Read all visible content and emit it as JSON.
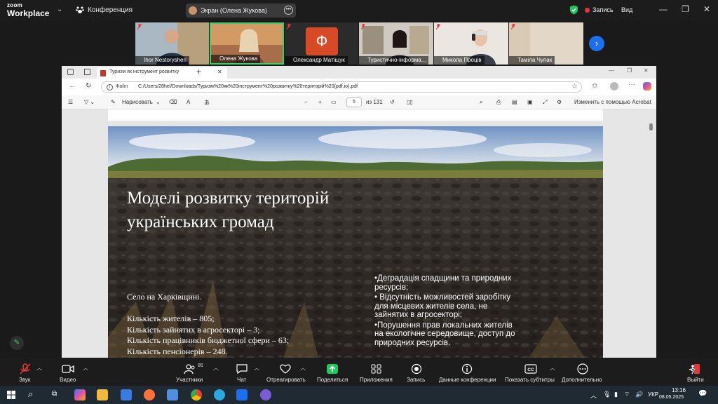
{
  "zoom": {
    "logo_top": "zoom",
    "logo_bottom": "Workplace",
    "conference_label": "Конференция",
    "share_label": "Экран (Олена Жукова)",
    "record_label": "Запись",
    "view_label": "Вид"
  },
  "participants": [
    {
      "name": "Ihor Nestoryshen"
    },
    {
      "name": "Олена Жукова"
    },
    {
      "name": "Олександр Матіщук",
      "initial": "Ф"
    },
    {
      "name": "Туристично-інформа..."
    },
    {
      "name": "Микола Проців"
    },
    {
      "name": "Таміла Чупак"
    }
  ],
  "browser": {
    "tab_title": "Туризм як інструмент розвитку",
    "address_prefix": "Файл",
    "address_url": "C:/Users/28hel/Downloads/Туризм%20як%20інструмент%20розвитку%20територій%20(pdf.io).pdf"
  },
  "pdf_toolbar": {
    "draw_label": "Нарисовать",
    "page_current": "5",
    "page_total": "из 131",
    "edit_label": "Изменить с помощью Acrobat"
  },
  "slide": {
    "title_line1": "Моделі розвитку територій",
    "title_line2": "українських громад",
    "caption": "Село на Харківщині.",
    "stats": [
      "Кількість жителів – 805;",
      "Кількість зайнятих в агросекторі – 3;",
      "Кількість працівників бюджетної сфери – 63;",
      "Кількість пенсіонерів – 248."
    ],
    "bullets": [
      "•Деградація спадщини та природних ресурсів;",
      "• Відсутність можливостей заробітку для місцевих жителів села, не зайнятих в агросекторі;",
      "•Порушення прав локальних жителів на екологічне середовище, доступ до природних ресурсів."
    ]
  },
  "toolbar": {
    "audio": "Звук",
    "video": "Видео",
    "participants": "Участники",
    "participants_count": "85",
    "chat": "Чат",
    "react": "Отреагировать",
    "share": "Поделиться",
    "apps": "Приложения",
    "record": "Запись",
    "meeting_info": "Данные конференции",
    "captions": "Показать субтитры",
    "more": "Дополнительно",
    "leave": "Выйти"
  },
  "taskbar": {
    "lang": "УКР",
    "time": "13:16",
    "date": "08.05.2025"
  },
  "colors": {
    "accent_blue": "#1d6ff2",
    "share_green": "#22c55e",
    "leave_red": "#e5383b",
    "active_speaker": "#3ad26b"
  }
}
